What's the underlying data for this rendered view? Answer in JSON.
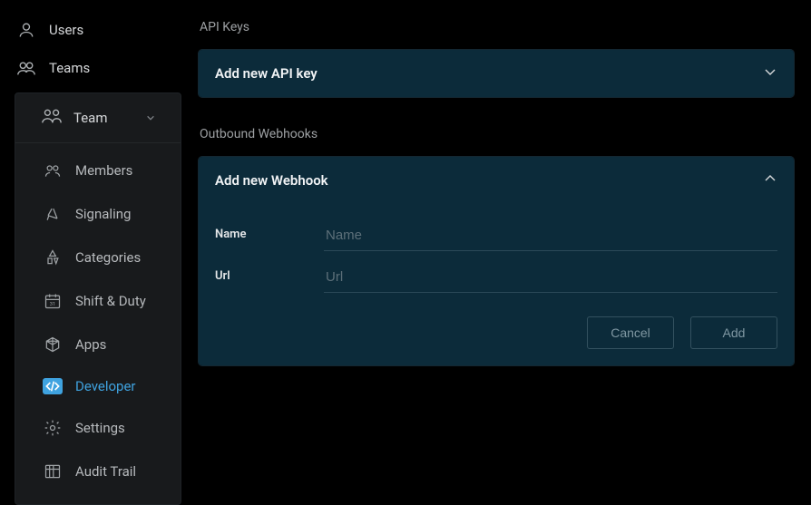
{
  "sidebar": {
    "top": [
      {
        "label": "Users"
      },
      {
        "label": "Teams"
      }
    ],
    "team_header": "Team",
    "sub": [
      {
        "label": "Members"
      },
      {
        "label": "Signaling"
      },
      {
        "label": "Categories"
      },
      {
        "label": "Shift & Duty"
      },
      {
        "label": "Apps"
      },
      {
        "label": "Developer"
      },
      {
        "label": "Settings"
      },
      {
        "label": "Audit Trail"
      }
    ]
  },
  "sections": {
    "api_keys": {
      "title": "API Keys",
      "panel_title": "Add new API key"
    },
    "webhooks": {
      "title": "Outbound Webhooks",
      "panel_title": "Add new Webhook",
      "fields": {
        "name": {
          "label": "Name",
          "placeholder": "Name",
          "value": ""
        },
        "url": {
          "label": "Url",
          "placeholder": "Url",
          "value": ""
        }
      },
      "buttons": {
        "cancel": "Cancel",
        "add": "Add"
      }
    }
  },
  "colors": {
    "accent": "#3fa3e0",
    "panel_bg": "#0c2b3a",
    "sidebar_bg": "#181a1c"
  }
}
